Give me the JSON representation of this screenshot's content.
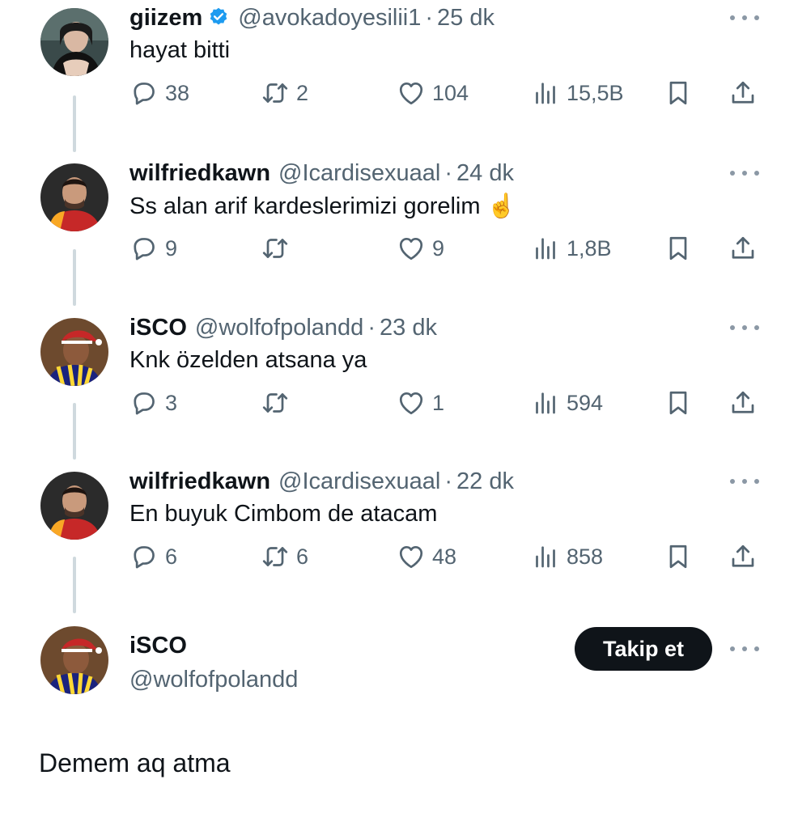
{
  "tweets": [
    {
      "name": "giizem",
      "verified": true,
      "handle": "@avokadoyesilii1",
      "time": "25 dk",
      "text": "hayat bitti",
      "replies": "38",
      "retweets": "2",
      "likes": "104",
      "views": "15,5B"
    },
    {
      "name": "wilfriedkawn",
      "verified": false,
      "handle": "@Icardisexuaal",
      "time": "24 dk",
      "text": "Ss alan arif kardeslerimizi gorelim ☝️",
      "replies": "9",
      "retweets": "",
      "likes": "9",
      "views": "1,8B"
    },
    {
      "name": "iSCO",
      "verified": false,
      "handle": "@wolfofpolandd",
      "time": "23 dk",
      "text": "Knk özelden atsana ya",
      "replies": "3",
      "retweets": "",
      "likes": "1",
      "views": "594"
    },
    {
      "name": "wilfriedkawn",
      "verified": false,
      "handle": "@Icardisexuaal",
      "time": "22 dk",
      "text": "En buyuk Cimbom de atacam",
      "replies": "6",
      "retweets": "6",
      "likes": "48",
      "views": "858"
    }
  ],
  "focused": {
    "name": "iSCO",
    "handle": "@wolfofpolandd",
    "follow_label": "Takip et",
    "text": "Demem aq atma"
  },
  "colors": {
    "text": "#0f1419",
    "secondary": "#536471",
    "verified_blue": "#1d9bf0",
    "thread_line": "#cfd9de",
    "button_bg": "#0f1419"
  },
  "icons": [
    "reply-icon",
    "retweet-icon",
    "like-icon",
    "views-icon",
    "bookmark-icon",
    "share-icon",
    "verified-icon",
    "more-icon"
  ]
}
